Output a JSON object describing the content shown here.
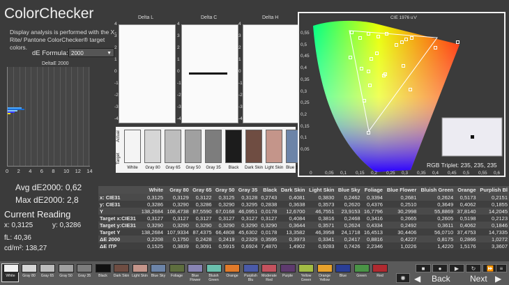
{
  "title": "ColorChecker",
  "description": "Display analysis is performed with the X-Rite/ Pantone ColorChecker® target colors.",
  "formula": {
    "label": "dE Formula:",
    "value": "2000"
  },
  "histogram": {
    "title": "DeltaE 2000",
    "ticks": [
      "0",
      "2",
      "4",
      "6",
      "8",
      "10",
      "12",
      "14"
    ]
  },
  "stats": {
    "avg": "Avg dE2000: 0,62",
    "max": "Max dE2000: 2,8"
  },
  "current": {
    "heading": "Current Reading",
    "x": "x: 0,3125",
    "y": "y: 0,3286",
    "fl": "fL: 40,36",
    "cd": "cd/m²: 138,27"
  },
  "delta_panels": [
    {
      "title": "Delta L"
    },
    {
      "title": "Delta C"
    },
    {
      "title": "Delta H"
    }
  ],
  "delta_ticks": [
    "4",
    "3",
    "2",
    "1",
    "0",
    "-1",
    "-2",
    "-3",
    "-4"
  ],
  "swatch_side_labels": {
    "actual": "Actual",
    "target": "Target"
  },
  "swatches": [
    {
      "label": "White",
      "color": "#f4f4f4"
    },
    {
      "label": "Gray 80",
      "color": "#d6d6d6"
    },
    {
      "label": "Gray 65",
      "color": "#bdbdbd"
    },
    {
      "label": "Gray 50",
      "color": "#a0a0a0"
    },
    {
      "label": "Gray 35",
      "color": "#7d7d7d"
    },
    {
      "label": "Black",
      "color": "#1c1c1c"
    },
    {
      "label": "Dark Skin",
      "color": "#6f4d42"
    },
    {
      "label": "Light Skin",
      "color": "#c4958a"
    },
    {
      "label": "Blue Sky",
      "color": "#6c84a8"
    }
  ],
  "cie": {
    "title": "CIE 1976 u'v'",
    "yticks": [
      "0,55",
      "0,5",
      "0,45",
      "0,4",
      "0,35",
      "0,3",
      "0,25",
      "0,2",
      "0,15",
      "0,1",
      "0,05"
    ],
    "xticks": [
      "0",
      "0,05",
      "0,1",
      "0,15",
      "0,2",
      "0,25",
      "0,3",
      "0,35",
      "0,4",
      "0,45",
      "0,5",
      "0,55",
      "0,6"
    ],
    "rgb_triplet": "RGB Triplet: 235, 235, 235"
  },
  "table": {
    "columns": [
      "",
      "White",
      "Gray 80",
      "Gray 65",
      "Gray 50",
      "Gray 35",
      "Black",
      "Dark Skin",
      "Light Skin",
      "Blue Sky",
      "Foliage",
      "Blue Flower",
      "Bluish Green",
      "Orange",
      "Purplish Bl"
    ],
    "rows": [
      [
        "x: CIE31",
        "0,3125",
        "0,3129",
        "0,3122",
        "0,3125",
        "0,3128",
        "0,2743",
        "0,4081",
        "0,3830",
        "0,2462",
        "0,3394",
        "0,2681",
        "0,2624",
        "0,5173",
        "0,2151"
      ],
      [
        "y: CIE31",
        "0,3286",
        "0,3290",
        "0,3286",
        "0,3290",
        "0,3295",
        "0,2838",
        "0,3638",
        "0,3573",
        "0,2620",
        "0,4376",
        "0,2510",
        "0,3649",
        "0,4062",
        "0,1855"
      ],
      [
        "Y",
        "138,2684",
        "108,4738",
        "87,5590",
        "67,0168",
        "46,0951",
        "0,0178",
        "12,6700",
        "46,7551",
        "23,9153",
        "16,7796",
        "30,2998",
        "55,8869",
        "37,8140",
        "14,2045"
      ],
      [
        "Target x:CIE31",
        "0,3127",
        "0,3127",
        "0,3127",
        "0,3127",
        "0,3127",
        "0,3127",
        "0,4084",
        "0,3816",
        "0,2468",
        "0,3416",
        "0,2665",
        "0,2605",
        "0,5198",
        "0,2123"
      ],
      [
        "Target y:CIE31",
        "0,3290",
        "0,3290",
        "0,3290",
        "0,3290",
        "0,3290",
        "0,3290",
        "0,3644",
        "0,3571",
        "0,2624",
        "0,4334",
        "0,2492",
        "0,3611",
        "0,4062",
        "0,1846"
      ],
      [
        "Target Y",
        "138,2684",
        "107,9334",
        "87,4375",
        "66,4808",
        "45,6302",
        "0,0178",
        "13,3582",
        "46,3958",
        "24,1718",
        "16,4513",
        "30,4406",
        "56,0710",
        "37,4753",
        "14,7335"
      ],
      [
        "ΔE 2000",
        "0,2208",
        "0,1750",
        "0,2428",
        "0,2419",
        "0,2329",
        "0,3595",
        "0,3973",
        "0,3341",
        "0,2417",
        "0,8816",
        "0,4227",
        "0,8175",
        "0,2866",
        "1,0272"
      ],
      [
        "ΔE ITP",
        "0,1525",
        "0,3839",
        "0,3091",
        "0,5915",
        "0,6924",
        "7,4870",
        "1,4902",
        "0,9283",
        "0,7426",
        "2,2346",
        "1,0226",
        "1,4220",
        "1,5176",
        "3,3607"
      ]
    ]
  },
  "bottom_strip": [
    {
      "label": "White",
      "color": "#f2f2f2"
    },
    {
      "label": "Gray 80",
      "color": "#d6d6d6"
    },
    {
      "label": "Gray 65",
      "color": "#bdbdbd"
    },
    {
      "label": "Gray 50",
      "color": "#a0a0a0"
    },
    {
      "label": "Gray 35",
      "color": "#7d7d7d"
    },
    {
      "label": "Black",
      "color": "#111111"
    },
    {
      "label": "Dark Skin",
      "color": "#6f4d42"
    },
    {
      "label": "Light Skin",
      "color": "#c4958a"
    },
    {
      "label": "Blue Sky",
      "color": "#6c84a8"
    },
    {
      "label": "Foliage",
      "color": "#5e6e3e"
    },
    {
      "label": "Blue Flower",
      "color": "#8884b3"
    },
    {
      "label": "Bluish Green",
      "color": "#6ac0ad"
    },
    {
      "label": "Orange",
      "color": "#e07a2a"
    },
    {
      "label": "Purplish Blu",
      "color": "#4a5aa8"
    },
    {
      "label": "Moderate Red",
      "color": "#c4525e"
    },
    {
      "label": "Purple",
      "color": "#5e3a6e"
    },
    {
      "label": "Yellow Green",
      "color": "#a2bc44"
    },
    {
      "label": "Orange Yellow",
      "color": "#e8a22c"
    },
    {
      "label": "Blue",
      "color": "#2a3e96"
    },
    {
      "label": "Green",
      "color": "#4a9446"
    },
    {
      "label": "Red",
      "color": "#b02a30"
    }
  ],
  "nav": {
    "back": "Back",
    "next": "Next"
  }
}
